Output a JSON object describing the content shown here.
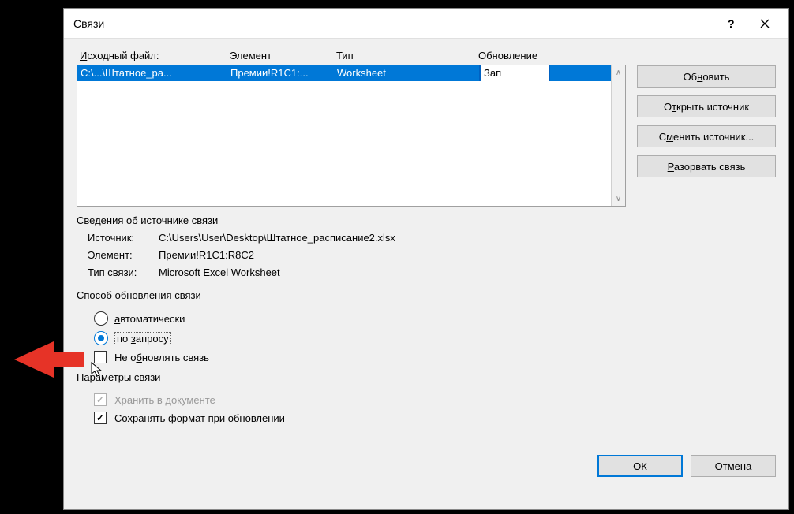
{
  "title": "Связи",
  "columns": {
    "source": "Исходный файл:",
    "element": "Элемент",
    "type": "Тип",
    "update": "Обновление"
  },
  "rows": [
    {
      "source": "C:\\...\\Штатное_ра...",
      "element": "Премии!R1C1:...",
      "type": "Worksheet",
      "update": "Зап"
    }
  ],
  "buttons": {
    "update_now": "Обновить",
    "open_source": "Открыть источник",
    "change_source": "Сменить источник...",
    "break_link": "Разорвать связь"
  },
  "info_section": {
    "heading": "Сведения об источнике связи",
    "source_label": "Источник:",
    "source_value": "C:\\Users\\User\\Desktop\\Штатное_расписание2.xlsx",
    "element_label": "Элемент:",
    "element_value": "Премии!R1C1:R8C2",
    "type_label": "Тип связи:",
    "type_value": "Microsoft Excel Worksheet"
  },
  "update_section": {
    "heading": "Способ обновления связи",
    "auto": "автоматически",
    "on_request": "по запросу",
    "dont_update": "Не обновлять связь"
  },
  "params_section": {
    "heading": "Параметры связи",
    "store": "Хранить в документе",
    "preserve_format": "Сохранять формат при обновлении"
  },
  "dialog_buttons": {
    "ok": "ОК",
    "cancel": "Отмена"
  }
}
